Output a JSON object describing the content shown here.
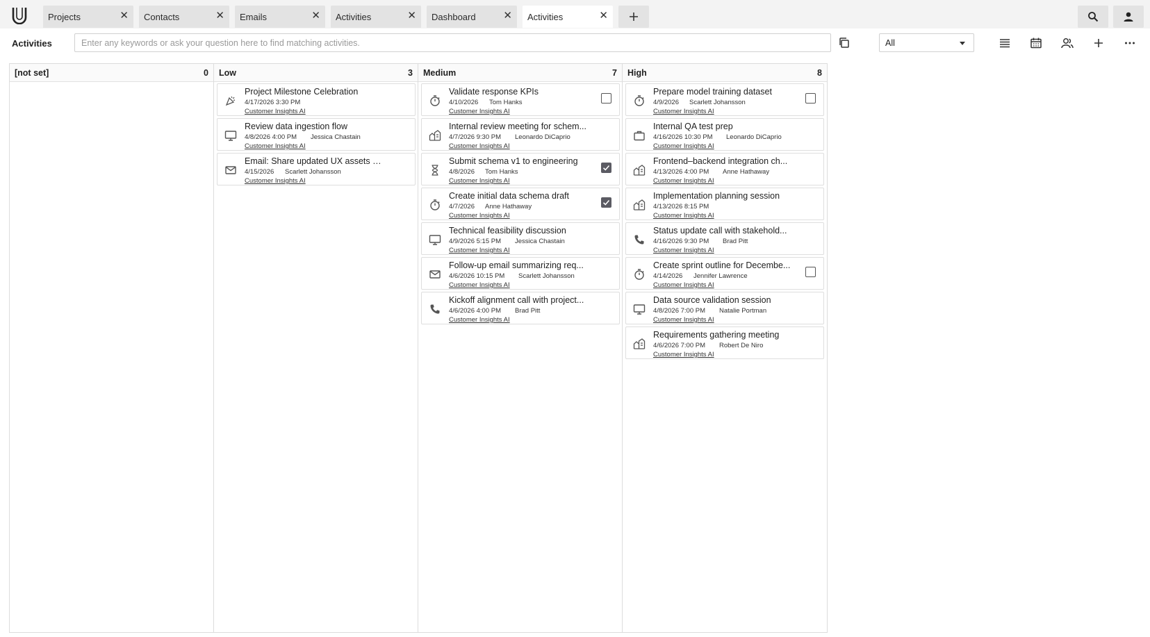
{
  "tabs": [
    {
      "label": "Projects"
    },
    {
      "label": "Contacts"
    },
    {
      "label": "Emails"
    },
    {
      "label": "Activities"
    },
    {
      "label": "Dashboard"
    },
    {
      "label": "Activities",
      "active": true
    }
  ],
  "tab_close_glyph": "✕",
  "toolbar": {
    "title": "Activities",
    "search_placeholder": "Enter any keywords or ask your question here to find matching activities.",
    "filter_value": "All"
  },
  "icons": {
    "top": [
      "search-icon",
      "user-icon",
      "add-tab-icon",
      "app-logo"
    ],
    "toolbar": [
      "copy-icon",
      "list-view-icon",
      "calendar-icon",
      "people-icon",
      "add-icon",
      "more-icon"
    ],
    "card_types": [
      "celebration-icon",
      "monitor-icon",
      "mail-icon",
      "stopwatch-icon",
      "meeting-icon",
      "hourglass-icon",
      "phone-icon",
      "briefcase-icon"
    ]
  },
  "colors": {
    "checkbox_checked": "#5b5b63",
    "tab_inactive": "#e3e3e3"
  },
  "columns": [
    {
      "title": "[not set]",
      "count": "0",
      "cards": []
    },
    {
      "title": "Low",
      "count": "3",
      "cards": [
        {
          "icon": "celebration-icon",
          "title": "Project Milestone Celebration",
          "date": "4/17/2026 3:30 PM",
          "person": "",
          "project": "Customer Insights AI"
        },
        {
          "icon": "monitor-icon",
          "title": "Review data ingestion flow",
          "date": "4/8/2026 4:00 PM",
          "person": "Jessica Chastain",
          "project": "Customer Insights AI"
        },
        {
          "icon": "mail-icon",
          "title": "Email: Share updated UX assets w...",
          "date": "4/15/2026",
          "person": "Scarlett Johansson",
          "project": "Customer Insights AI"
        }
      ]
    },
    {
      "title": "Medium",
      "count": "7",
      "cards": [
        {
          "icon": "stopwatch-icon",
          "title": "Validate response KPIs",
          "date": "4/10/2026",
          "person": "Tom Hanks",
          "project": "Customer Insights AI",
          "check": "off"
        },
        {
          "icon": "meeting-icon",
          "title": "Internal review meeting for schem...",
          "date": "4/7/2026 9:30 PM",
          "person": "Leonardo DiCaprio",
          "project": "Customer Insights AI"
        },
        {
          "icon": "hourglass-icon",
          "title": "Submit schema v1 to engineering",
          "date": "4/8/2026",
          "person": "Tom Hanks",
          "project": "Customer Insights AI",
          "check": "on"
        },
        {
          "icon": "stopwatch-icon",
          "title": "Create initial data schema draft",
          "date": "4/7/2026",
          "person": "Anne Hathaway",
          "project": "Customer Insights AI",
          "check": "on"
        },
        {
          "icon": "monitor-icon",
          "title": "Technical feasibility discussion",
          "date": "4/9/2026 5:15 PM",
          "person": "Jessica Chastain",
          "project": "Customer Insights AI"
        },
        {
          "icon": "mail-icon",
          "title": "Follow-up email summarizing req...",
          "date": "4/6/2026 10:15 PM",
          "person": "Scarlett Johansson",
          "project": "Customer Insights AI"
        },
        {
          "icon": "phone-icon",
          "title": "Kickoff alignment call with project...",
          "date": "4/6/2026 4:00 PM",
          "person": "Brad Pitt",
          "project": "Customer Insights AI"
        }
      ]
    },
    {
      "title": "High",
      "count": "8",
      "cards": [
        {
          "icon": "stopwatch-icon",
          "title": "Prepare model training dataset",
          "date": "4/9/2026",
          "person": "Scarlett Johansson",
          "project": "Customer Insights AI",
          "check": "off"
        },
        {
          "icon": "briefcase-icon",
          "title": "Internal QA test prep",
          "date": "4/16/2026 10:30 PM",
          "person": "Leonardo DiCaprio",
          "project": "Customer Insights AI"
        },
        {
          "icon": "meeting-icon",
          "title": "Frontend–backend integration ch...",
          "date": "4/13/2026 4:00 PM",
          "person": "Anne Hathaway",
          "project": "Customer Insights AI"
        },
        {
          "icon": "meeting-icon",
          "title": "Implementation planning session",
          "date": "4/13/2026 8:15 PM",
          "person": "",
          "project": "Customer Insights AI"
        },
        {
          "icon": "phone-icon",
          "title": "Status update call with stakehold...",
          "date": "4/16/2026 9:30 PM",
          "person": "Brad Pitt",
          "project": "Customer Insights AI"
        },
        {
          "icon": "stopwatch-icon",
          "title": "Create sprint outline for Decembe...",
          "date": "4/14/2026",
          "person": "Jennifer Lawrence",
          "project": "Customer Insights AI",
          "check": "off"
        },
        {
          "icon": "monitor-icon",
          "title": "Data source validation session",
          "date": "4/8/2026 7:00 PM",
          "person": "Natalie Portman",
          "project": "Customer Insights AI"
        },
        {
          "icon": "meeting-icon",
          "title": "Requirements gathering meeting",
          "date": "4/6/2026 7:00 PM",
          "person": "Robert De Niro",
          "project": "Customer Insights AI"
        }
      ]
    }
  ]
}
